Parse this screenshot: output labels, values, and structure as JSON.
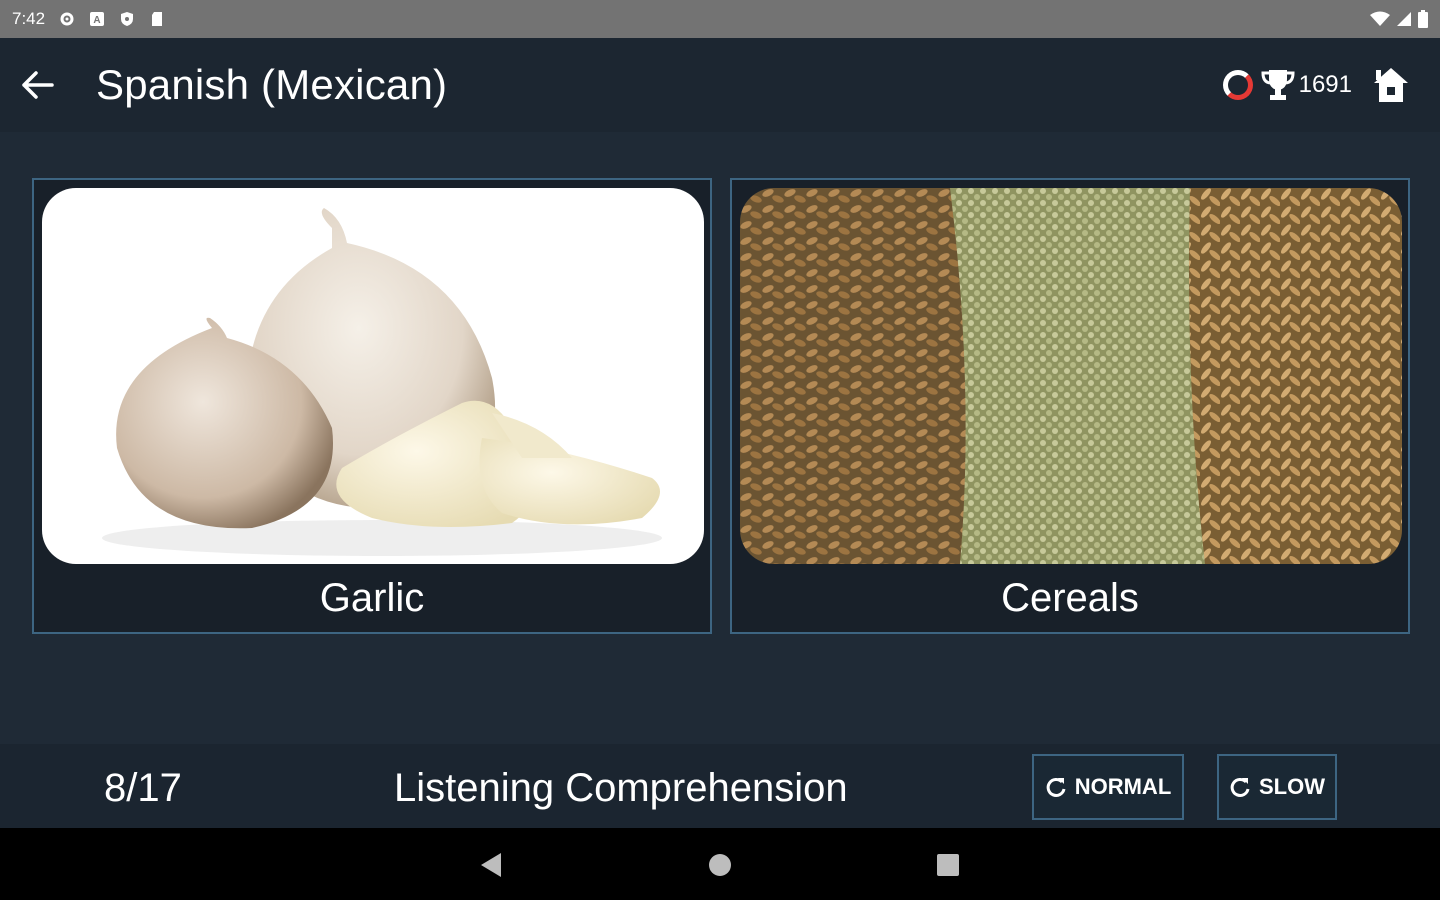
{
  "status_bar": {
    "time": "7:42",
    "icons": [
      "settings-icon",
      "a-icon",
      "shield-icon",
      "sd-card-icon",
      "wifi-icon",
      "signal-icon",
      "battery-icon"
    ]
  },
  "app_bar": {
    "title": "Spanish (Mexican)",
    "score": "1691",
    "icons": [
      "back-arrow-icon",
      "progress-ring-icon",
      "trophy-icon",
      "home-icon"
    ]
  },
  "cards": [
    {
      "label": "Garlic",
      "image": "garlic-photo"
    },
    {
      "label": "Cereals",
      "image": "cereal-grains-photo"
    }
  ],
  "bottom_bar": {
    "progress": "8/17",
    "mode": "Listening Comprehension",
    "normal_label": "NORMAL",
    "slow_label": "SLOW"
  },
  "nav_bar": {
    "icons": [
      "nav-back-icon",
      "nav-home-icon",
      "nav-recents-icon"
    ]
  },
  "colors": {
    "background": "#1f2a36",
    "app_bar": "#1c2631",
    "card_border": "#3d6582",
    "status_bar": "#737373",
    "ring_accent": "#e53935"
  }
}
